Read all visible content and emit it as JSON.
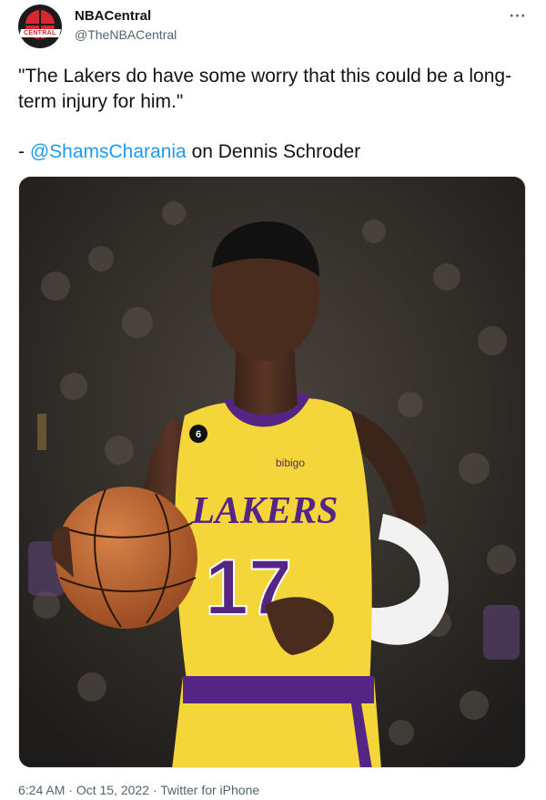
{
  "account": {
    "display_name": "NBACentral",
    "handle": "@TheNBACentral",
    "avatar_text": "CENTRAL"
  },
  "more_label": "···",
  "tweet": {
    "quote": "\"The Lakers do have some worry that this could be a long-term injury for him.\"",
    "attribution_prefix": "- ",
    "mention": "@ShamsCharania",
    "attribution_suffix": " on Dennis Schroder"
  },
  "photo": {
    "jersey_team": "LAKERS",
    "jersey_number": "17",
    "sponsor": "bibigo",
    "patch_number": "6"
  },
  "meta": {
    "time": "6:24 AM",
    "separator": " · ",
    "date": "Oct 15, 2022",
    "source": "Twitter for iPhone"
  }
}
